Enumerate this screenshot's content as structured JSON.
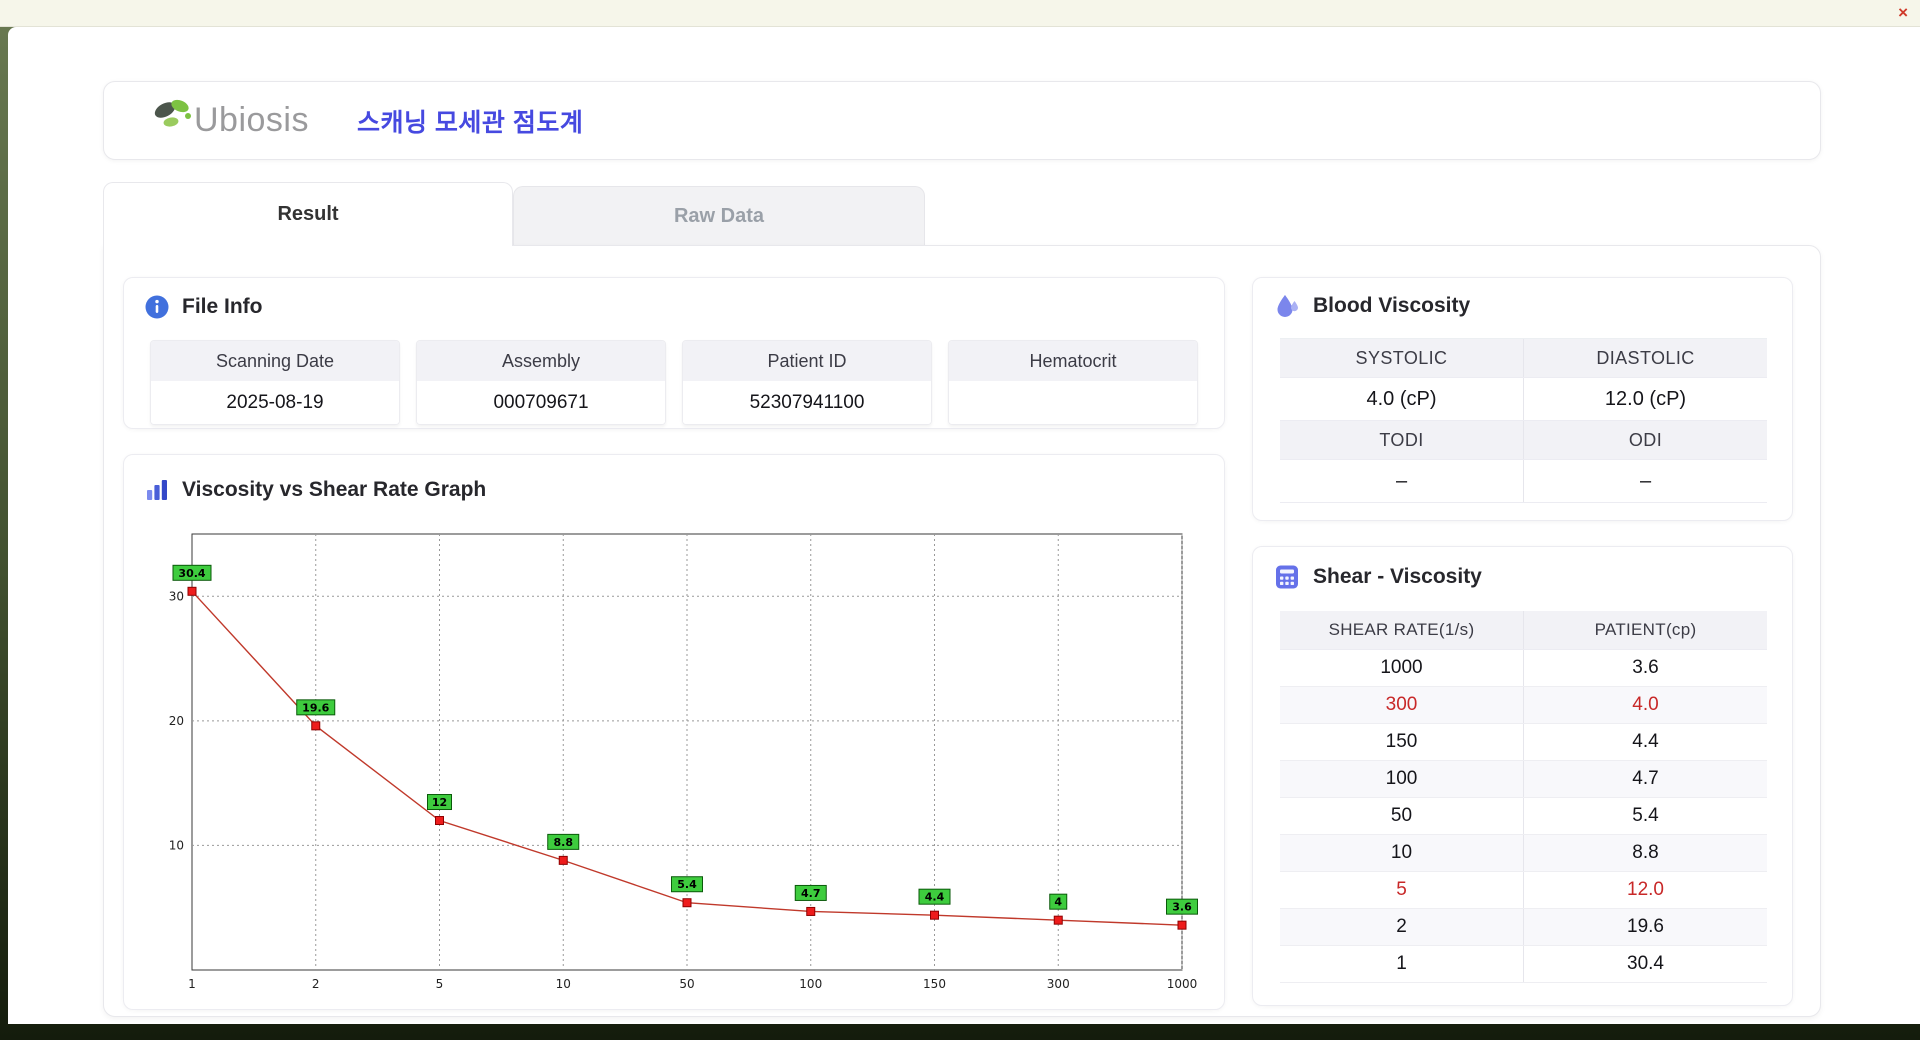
{
  "window": {
    "close_glyph": "×"
  },
  "header": {
    "logo_text": "Ubiosis",
    "title": "스캐닝 모세관 점도계"
  },
  "tabs": [
    {
      "label": "Result",
      "active": true
    },
    {
      "label": "Raw Data",
      "active": false
    }
  ],
  "file_info": {
    "title": "File Info",
    "fields": [
      {
        "label": "Scanning Date",
        "value": "2025-08-19"
      },
      {
        "label": "Assembly",
        "value": "000709671"
      },
      {
        "label": "Patient ID",
        "value": "52307941100"
      },
      {
        "label": "Hematocrit",
        "value": ""
      }
    ]
  },
  "graph_section": {
    "title": "Viscosity vs Shear Rate Graph"
  },
  "blood_viscosity": {
    "title": "Blood Viscosity",
    "rows": [
      {
        "labels": [
          "SYSTOLIC",
          "DIASTOLIC"
        ],
        "values": [
          "4.0 (cP)",
          "12.0 (cP)"
        ]
      },
      {
        "labels": [
          "TODI",
          "ODI"
        ],
        "values": [
          "–",
          "–"
        ]
      }
    ]
  },
  "shear_viscosity": {
    "title": "Shear - Viscosity",
    "columns": [
      "SHEAR RATE(1/s)",
      "PATIENT(cp)"
    ],
    "rows": [
      {
        "shear_rate": "1000",
        "patient": "3.6",
        "highlight": false
      },
      {
        "shear_rate": "300",
        "patient": "4.0",
        "highlight": true
      },
      {
        "shear_rate": "150",
        "patient": "4.4",
        "highlight": false
      },
      {
        "shear_rate": "100",
        "patient": "4.7",
        "highlight": false
      },
      {
        "shear_rate": "50",
        "patient": "5.4",
        "highlight": false
      },
      {
        "shear_rate": "10",
        "patient": "8.8",
        "highlight": false
      },
      {
        "shear_rate": "5",
        "patient": "12.0",
        "highlight": true
      },
      {
        "shear_rate": "2",
        "patient": "19.6",
        "highlight": false
      },
      {
        "shear_rate": "1",
        "patient": "30.4",
        "highlight": false
      }
    ]
  },
  "colors": {
    "accent_title": "#4649e0",
    "highlight_red": "#c82828",
    "tab_active_text": "#333333",
    "tab_inactive_text": "#9aa0a8"
  },
  "chart_data": {
    "type": "line",
    "title": "Viscosity vs Shear Rate Graph",
    "categories": [
      1,
      2,
      5,
      10,
      50,
      100,
      150,
      300,
      1000
    ],
    "values": [
      30.4,
      19.6,
      12,
      8.8,
      5.4,
      4.7,
      4.4,
      4,
      3.6
    ],
    "point_labels": [
      "30.4",
      "19.6",
      "12",
      "8.8",
      "5.4",
      "4.7",
      "4.4",
      "4",
      "3.6"
    ],
    "yticks": [
      10,
      20,
      30
    ],
    "ylim": [
      0,
      35
    ],
    "x_scale": "category",
    "grid": "dotted",
    "legend": "none",
    "line_color": "#c0392b",
    "marker_color": "#ee1c1c",
    "marker_shape": "square",
    "point_label_bg": "#3ecc3e"
  }
}
